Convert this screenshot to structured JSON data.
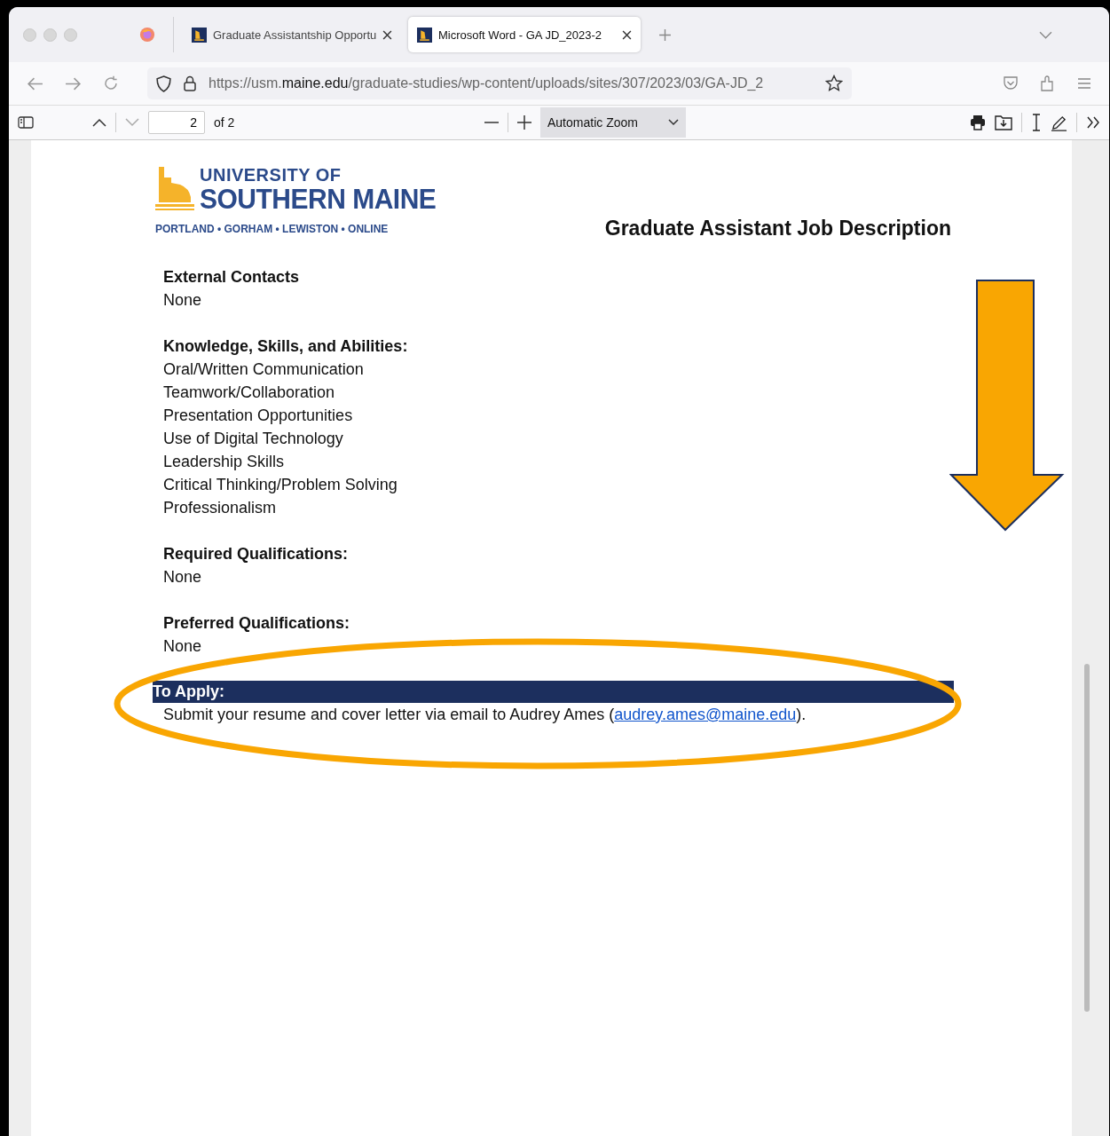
{
  "tabs": [
    {
      "label": "Graduate Assistantship Opportu",
      "selected": false
    },
    {
      "label": "Microsoft Word - GA JD_2023-2",
      "selected": true
    }
  ],
  "address_bar": {
    "url_start": "https://usm.",
    "url_host": "maine.edu",
    "url_rest": "/graduate-studies/wp-content/uploads/sites/307/2023/03/GA-JD_2"
  },
  "pdf_toolbar": {
    "page_number": "2",
    "page_count": "of 2",
    "zoom": "Automatic Zoom"
  },
  "document": {
    "logo": {
      "line_1": "UNIVERSITY OF",
      "line_2": "SOUTHERN MAINE",
      "campuses": "PORTLAND • GORHAM • LEWISTON • ONLINE"
    },
    "title": "Graduate Assistant Job Description",
    "sections": [
      {
        "heading": "External Contacts",
        "lines": [
          "None"
        ]
      },
      {
        "heading": "Knowledge, Skills, and Abilities:",
        "lines": [
          "Oral/Written Communication",
          "Teamwork/Collaboration",
          "Presentation Opportunities",
          "Use of Digital Technology",
          "Leadership Skills",
          "Critical Thinking/Problem Solving",
          "Professionalism"
        ]
      },
      {
        "heading": "Required Qualifications:",
        "lines": [
          "None"
        ]
      },
      {
        "heading": "Preferred Qualifications:",
        "lines": [
          "None"
        ]
      }
    ],
    "apply": {
      "heading": "To Apply:",
      "text_before": "Submit your resume and cover letter via email to Audrey Ames (",
      "link": "audrey.ames@maine.edu",
      "text_after": ")."
    }
  }
}
